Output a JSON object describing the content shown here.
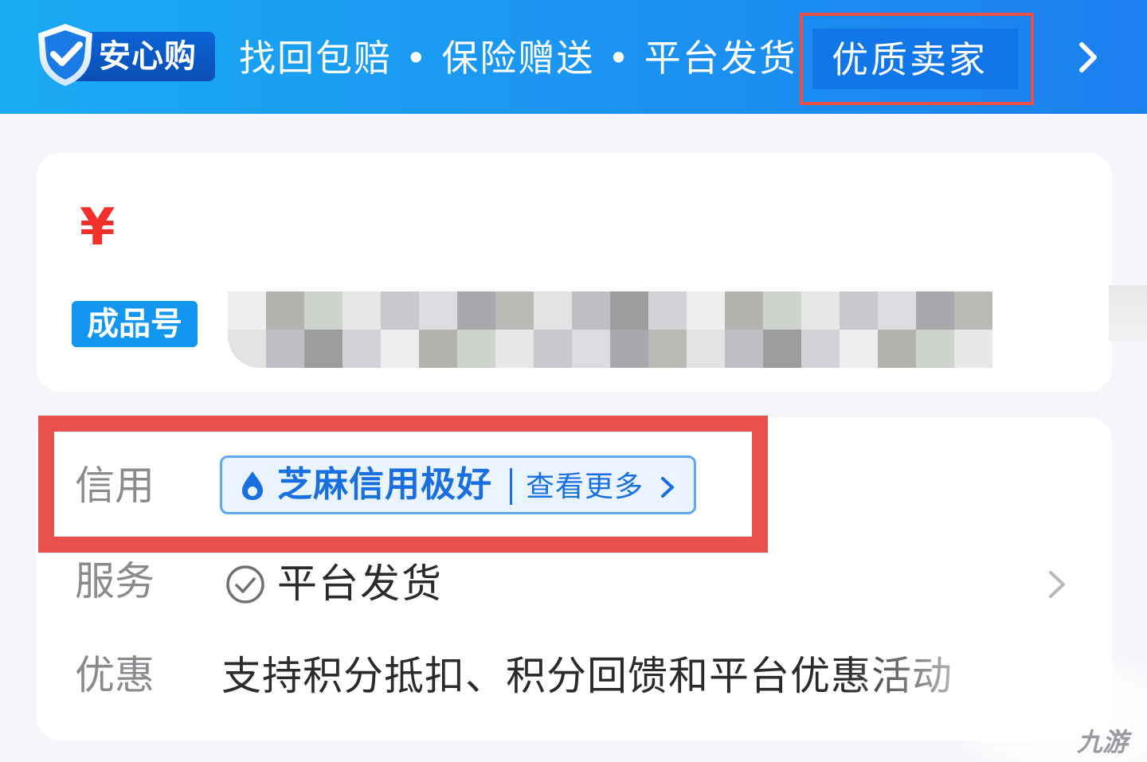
{
  "banner": {
    "badge_label": "安心购",
    "slogan": "找回包赔 • 保险赠送 • 平台发货",
    "highlight_label": "优质卖家",
    "colors": {
      "banner": "#1b93f2",
      "highlight_box": "#e7514a"
    }
  },
  "price_card": {
    "currency": "¥",
    "tag": "成品号"
  },
  "info": {
    "credit": {
      "label": "信用",
      "main": "芝麻信用极好",
      "more": "查看更多",
      "icon": "sesame-drop-icon"
    },
    "service": {
      "label": "服务",
      "value": "平台发货",
      "icon": "check-circle-icon"
    },
    "promo": {
      "label": "优惠",
      "value": "支持积分抵扣、积分回馈和平台优惠活动"
    }
  },
  "watermark": {
    "text": "九游"
  }
}
